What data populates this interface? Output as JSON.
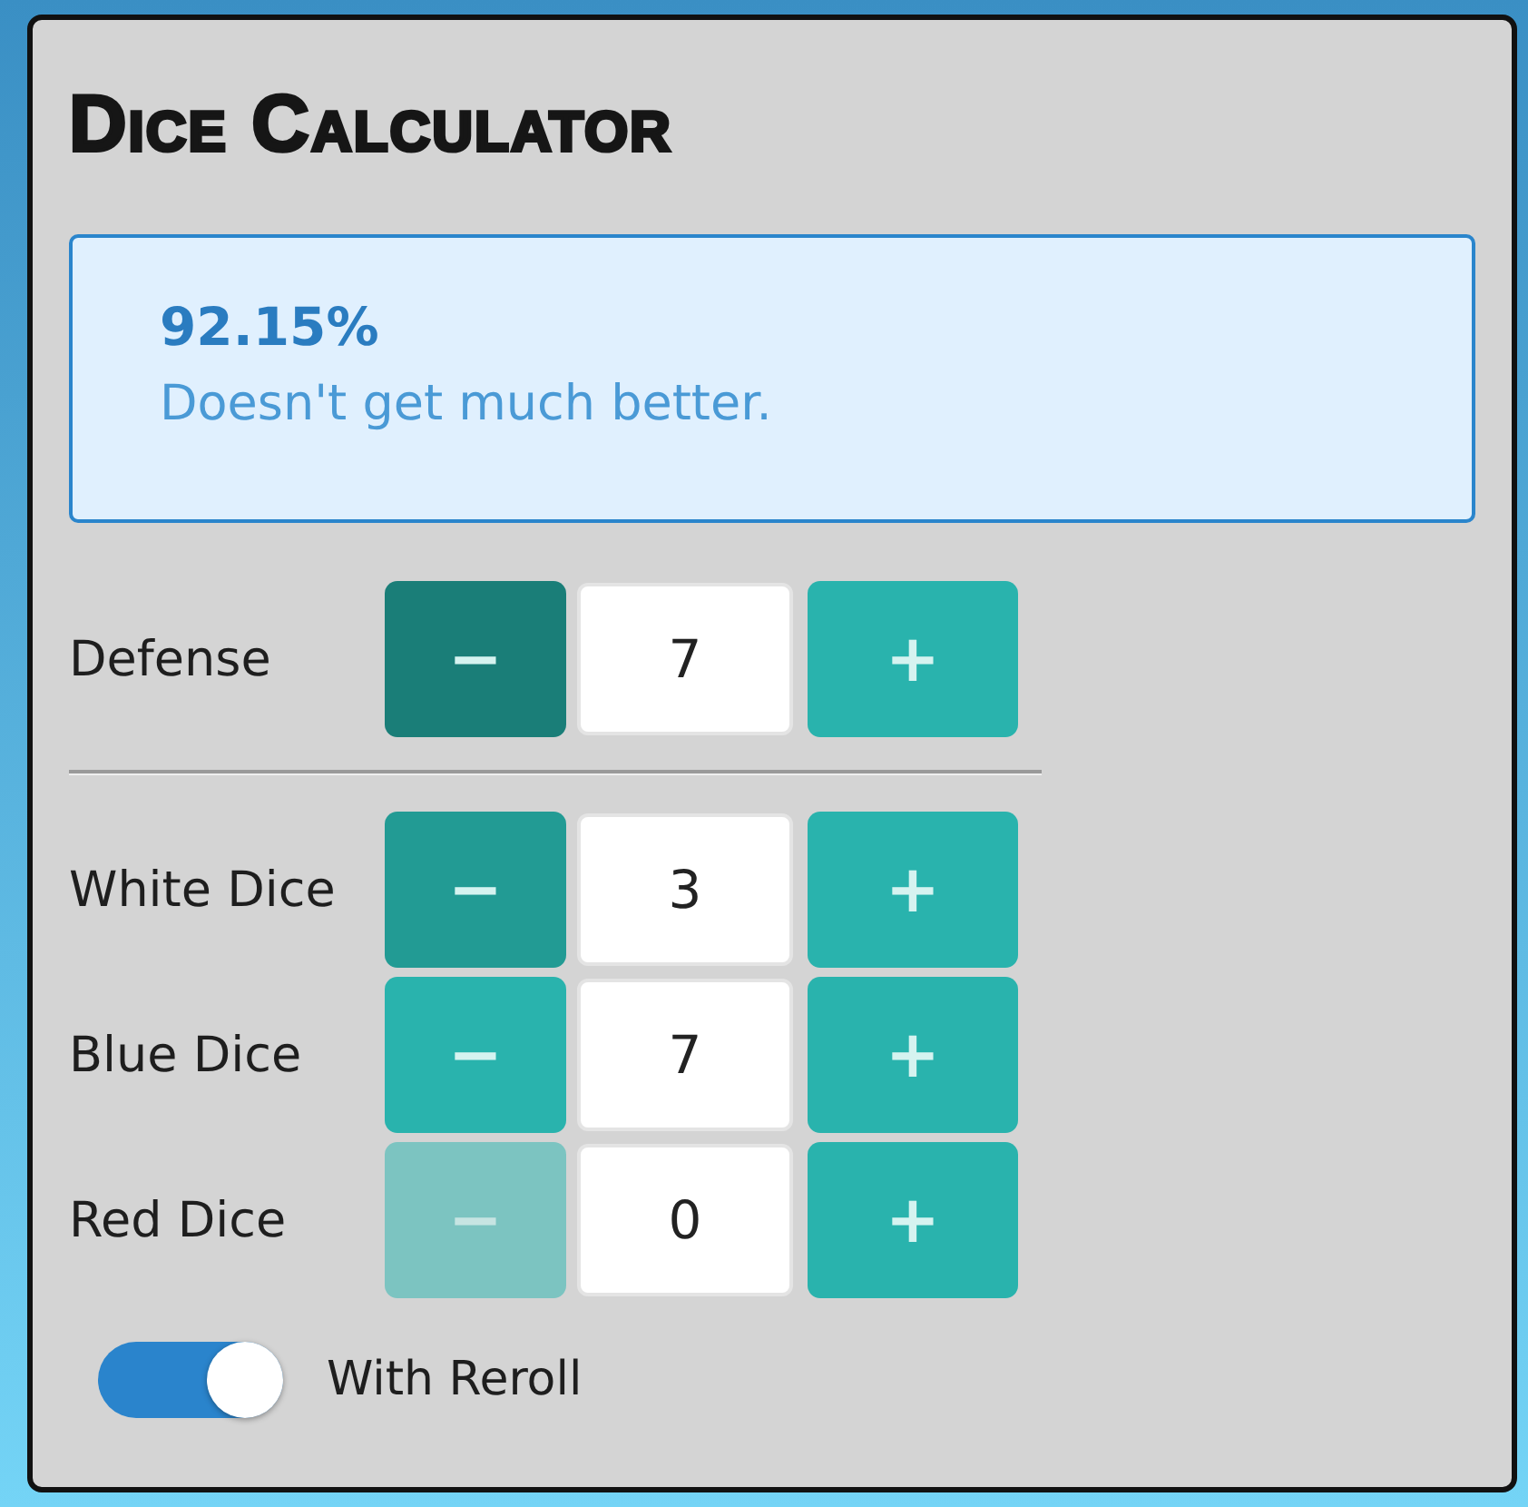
{
  "title": "Dice Calculator",
  "result": {
    "percentage": "92.15%",
    "message": "Doesn't get much better."
  },
  "rows": [
    {
      "kind": "stepper",
      "label": "Defense",
      "minus": {
        "text": "−",
        "pressed": true,
        "hovered": false,
        "disabled": false
      },
      "value": "7",
      "plus": {
        "text": "+"
      }
    },
    {
      "kind": "divider"
    },
    {
      "kind": "stepper",
      "label": "White Dice",
      "minus": {
        "text": "−",
        "pressed": false,
        "hovered": true,
        "disabled": false
      },
      "value": "3",
      "plus": {
        "text": "+"
      }
    },
    {
      "kind": "stepper",
      "label": "Blue Dice",
      "minus": {
        "text": "−",
        "pressed": false,
        "hovered": false,
        "disabled": false
      },
      "value": "7",
      "plus": {
        "text": "+"
      }
    },
    {
      "kind": "stepper",
      "label": "Red Dice",
      "minus": {
        "text": "−",
        "pressed": false,
        "hovered": false,
        "disabled": true
      },
      "value": "0",
      "plus": {
        "text": "+"
      }
    }
  ],
  "toggle": {
    "label": "With Reroll",
    "on": true
  }
}
